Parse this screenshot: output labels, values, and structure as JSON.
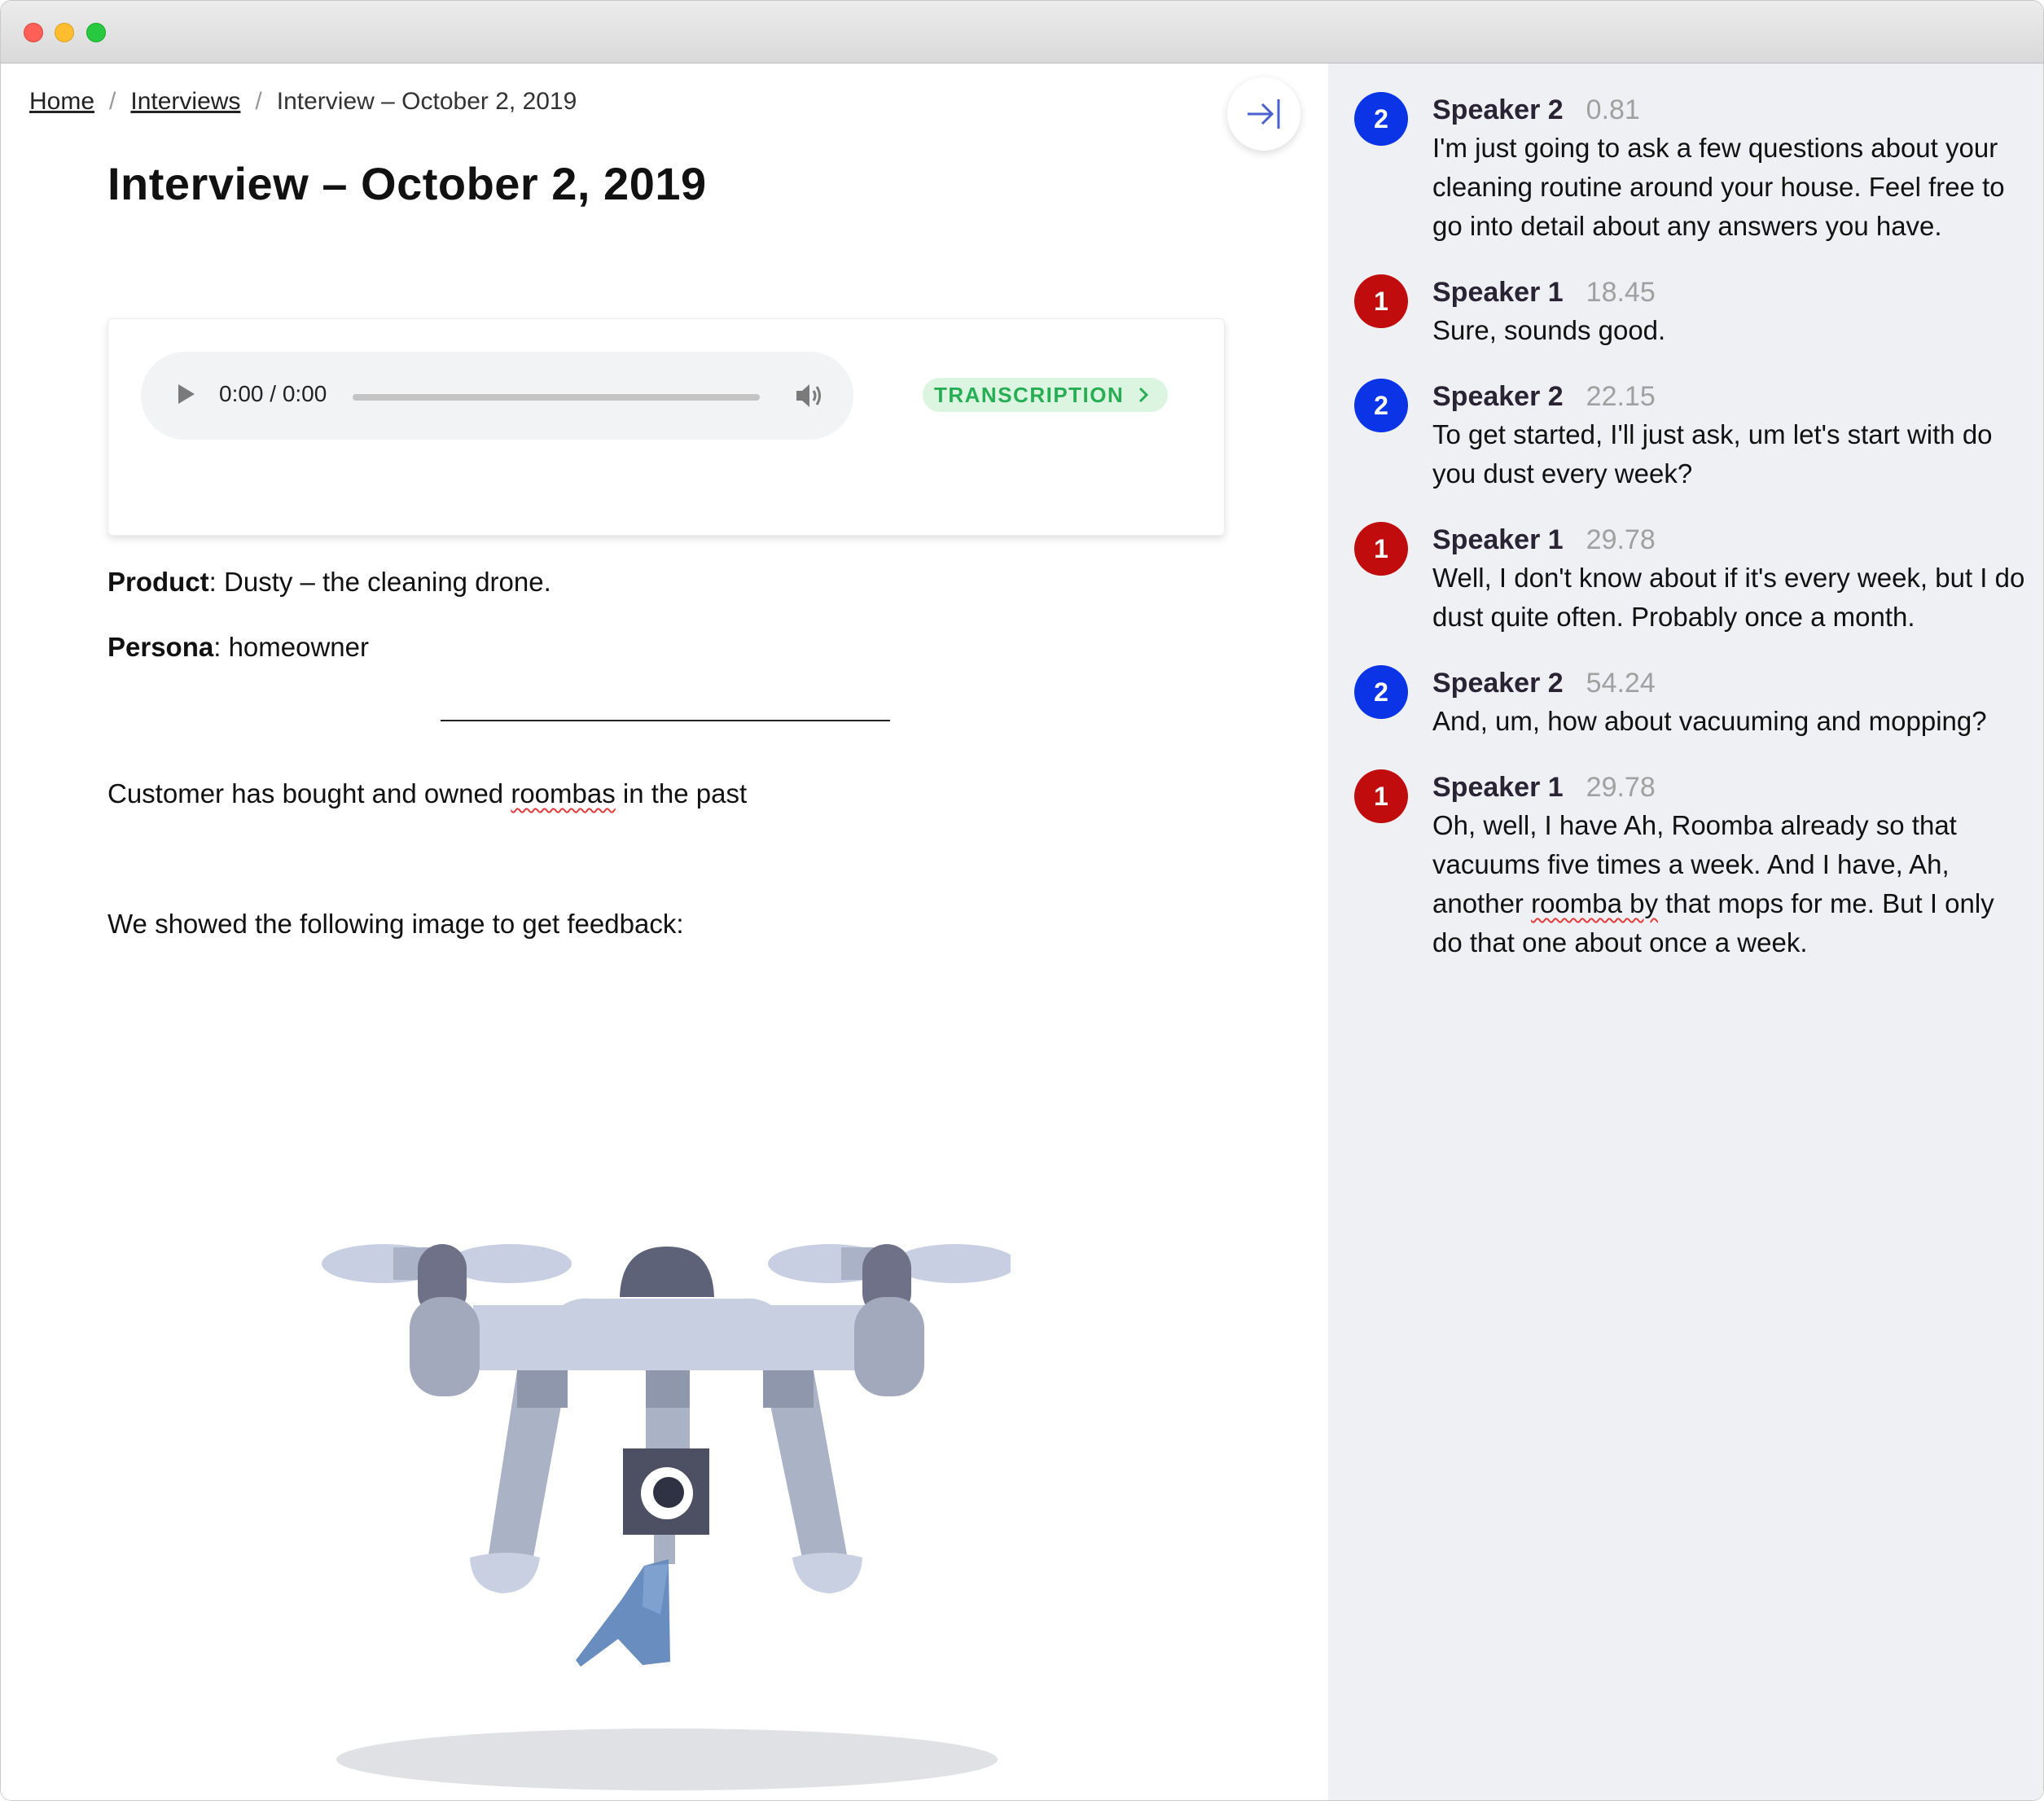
{
  "breadcrumb": {
    "home": "Home",
    "interviews": "Interviews",
    "current": "Interview – October 2, 2019",
    "separator": "/"
  },
  "page": {
    "title": "Interview – October 2, 2019"
  },
  "audio": {
    "time": "0:00 / 0:00",
    "progress": 0,
    "transcription_label": "TRANSCRIPTION"
  },
  "details": {
    "product_label": "Product",
    "product_value": ": Dusty – the cleaning drone.",
    "persona_label": "Persona",
    "persona_value": ": homeowner",
    "note_before": "Customer has bought and owned ",
    "note_flagged": "roombas",
    "note_after": " in the past",
    "feedback_intro": "We showed the following image to get feedback:"
  },
  "transcript": [
    {
      "badge": "2",
      "speaker": "Speaker 2",
      "time": "0.81",
      "text": "I'm just going to ask a few questions about your cleaning routine around your house. Feel free to go into detail about any answers you have."
    },
    {
      "badge": "1",
      "speaker": "Speaker 1",
      "time": "18.45",
      "text": "Sure, sounds good."
    },
    {
      "badge": "2",
      "speaker": "Speaker 2",
      "time": "22.15",
      "text": "To get started, I'll just ask, um let's start with do you dust every week?"
    },
    {
      "badge": "1",
      "speaker": "Speaker 1",
      "time": "29.78",
      "text": "Well, I don't know about if it's every week, but I do dust quite often. Probably once a month."
    },
    {
      "badge": "2",
      "speaker": "Speaker 2",
      "time": "54.24",
      "text": "And, um, how about vacuuming and mopping?"
    },
    {
      "badge": "1",
      "speaker": "Speaker 1",
      "time": "29.78",
      "text_before": "Oh, well, I have Ah, Roomba already so that vacuums five times a week. And I have, Ah, another ",
      "text_flagged": "roomba by",
      "text_after": " that mops for me. But I only do that one about once a week."
    }
  ],
  "colors": {
    "speaker_1": "#c00c0c",
    "speaker_2": "#0a34e6",
    "transcription_bg": "#dcf5e1",
    "transcription_text": "#27ae54",
    "sidebar_bg": "#eef0f4"
  },
  "icons": {
    "collapse": "arrow-right-to-bar-icon",
    "play": "play-icon",
    "volume": "volume-icon",
    "chevron": "chevron-right-icon"
  }
}
